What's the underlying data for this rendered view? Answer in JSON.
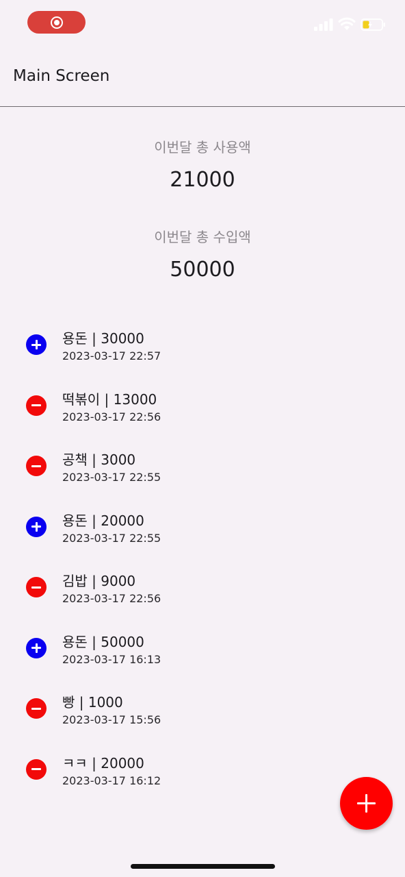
{
  "app_bar": {
    "title": "Main Screen"
  },
  "summary": {
    "spent_label": "이번달 총 사용액",
    "spent_value": "21000",
    "income_label": "이번달 총 수입액",
    "income_value": "50000"
  },
  "transactions": [
    {
      "type": "income",
      "icon": "plus-circle-icon",
      "title": "용돈 | 30000",
      "date": "2023-03-17 22:57"
    },
    {
      "type": "expense",
      "icon": "minus-circle-icon",
      "title": "떡볶이 | 13000",
      "date": "2023-03-17 22:56"
    },
    {
      "type": "expense",
      "icon": "minus-circle-icon",
      "title": "공책 | 3000",
      "date": "2023-03-17 22:55"
    },
    {
      "type": "income",
      "icon": "plus-circle-icon",
      "title": "용돈 | 20000",
      "date": "2023-03-17 22:55"
    },
    {
      "type": "expense",
      "icon": "minus-circle-icon",
      "title": "김밥 | 9000",
      "date": "2023-03-17 22:56"
    },
    {
      "type": "income",
      "icon": "plus-circle-icon",
      "title": "용돈 | 50000",
      "date": "2023-03-17 16:13"
    },
    {
      "type": "expense",
      "icon": "minus-circle-icon",
      "title": "빵 | 1000",
      "date": "2023-03-17 15:56"
    },
    {
      "type": "expense",
      "icon": "minus-circle-icon",
      "title": "ㅋㅋ | 20000",
      "date": "2023-03-17 16:12"
    }
  ],
  "fab": {
    "icon": "plus-icon"
  },
  "colors": {
    "background": "#f6f1f6",
    "income": "#0a00f0",
    "expense": "#f20a0a",
    "fab": "#ff0000",
    "record_indicator": "#d9403a"
  }
}
